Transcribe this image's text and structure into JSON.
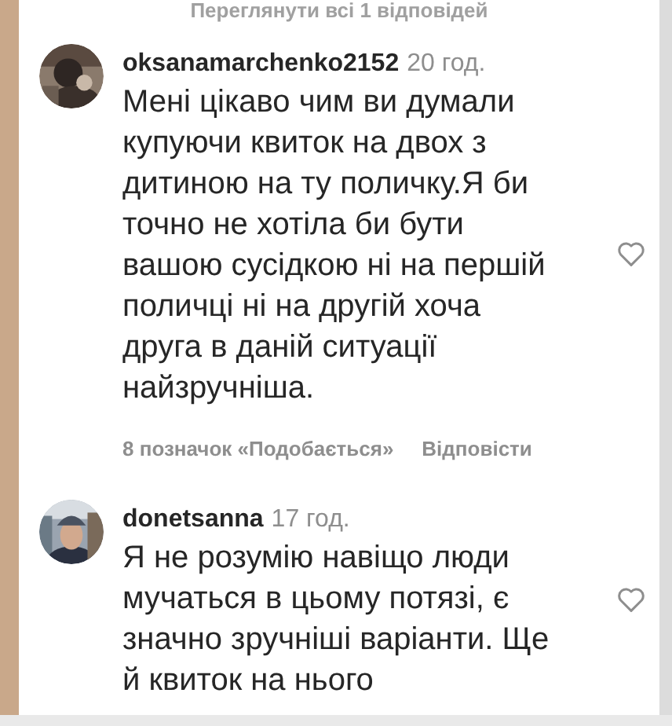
{
  "view_replies": "Переглянути всі 1 відповідей",
  "comments": [
    {
      "username": "oksanamarchenko2152",
      "time": "20 год.",
      "text": "Мені цікаво чим ви думали купуючи квиток на двох з дитиною на ту поличку.Я би точно не хотіла би бути вашою сусідкою ні на першій поличці ні на другій хоча друга в даній ситуації найзручніша.",
      "liked": false,
      "likes": "8 позначок «Подобається»",
      "reply": "Відповісти"
    },
    {
      "username": "donetsanna",
      "time": "17 год.",
      "text": "Я не розумію навіщо люди мучаться в цьому потязі, є значно зручніші варіанти. Ще й квиток на нього",
      "liked": false
    }
  ]
}
